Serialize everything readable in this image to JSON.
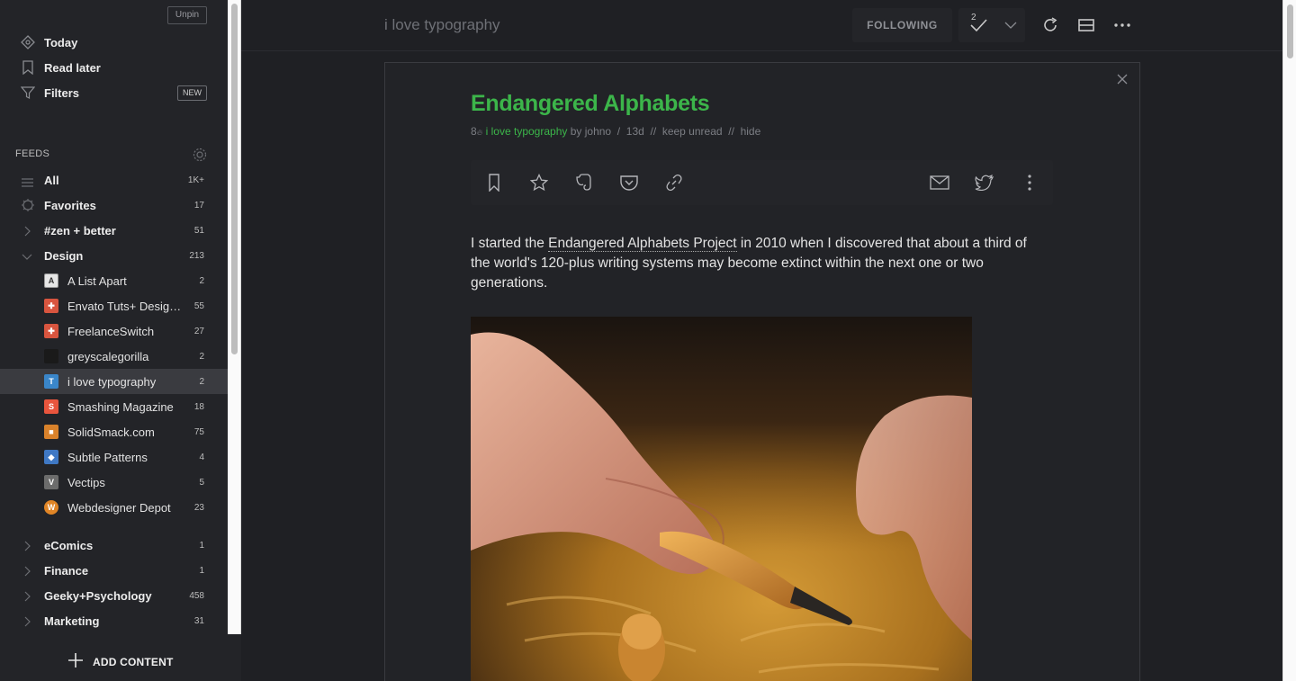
{
  "sidebar": {
    "unpin": "Unpin",
    "nav": [
      {
        "label": "Today",
        "icon": "today-icon"
      },
      {
        "label": "Read later",
        "icon": "bookmark-icon"
      },
      {
        "label": "Filters",
        "icon": "filter-icon",
        "badge": "NEW"
      }
    ],
    "feeds_label": "FEEDS",
    "groups_top": [
      {
        "label": "All",
        "count": "1K+",
        "icon": "list-icon"
      },
      {
        "label": "Favorites",
        "count": "17",
        "icon": "favorites-icon"
      },
      {
        "label": "#zen + better",
        "count": "51",
        "icon": "chevron-right-icon"
      },
      {
        "label": "Design",
        "count": "213",
        "icon": "chevron-down-icon"
      }
    ],
    "design_feeds": [
      {
        "label": "A List Apart",
        "count": "2",
        "favicon_color": "#e6e6e6",
        "favicon_text": "A"
      },
      {
        "label": "Envato Tuts+ Design & Illustration",
        "count": "55",
        "favicon_color": "#d8553f",
        "favicon_text": "+"
      },
      {
        "label": "FreelanceSwitch",
        "count": "27",
        "favicon_color": "#d8553f",
        "favicon_text": "+"
      },
      {
        "label": "greyscalegorilla",
        "count": "2",
        "favicon_color": "#1a1a1a",
        "favicon_text": ""
      },
      {
        "label": "i love typography",
        "count": "2",
        "favicon_color": "#3a86c9",
        "favicon_text": "T"
      },
      {
        "label": "Smashing Magazine",
        "count": "18",
        "favicon_color": "#e8553d",
        "favicon_text": "S"
      },
      {
        "label": "SolidSmack.com",
        "count": "75",
        "favicon_color": "#d9822b",
        "favicon_text": ""
      },
      {
        "label": "Subtle Patterns",
        "count": "4",
        "favicon_color": "#3f78c4",
        "favicon_text": "◆"
      },
      {
        "label": "Vectips",
        "count": "5",
        "favicon_color": "#6c6c6c",
        "favicon_text": "V"
      },
      {
        "label": "Webdesigner Depot",
        "count": "23",
        "favicon_color": "#e08526",
        "favicon_text": "W"
      }
    ],
    "groups_bottom": [
      {
        "label": "eComics",
        "count": "1"
      },
      {
        "label": "Finance",
        "count": "1"
      },
      {
        "label": "Geeky+Psychology",
        "count": "458"
      },
      {
        "label": "Marketing",
        "count": "31"
      }
    ],
    "add_content": "ADD CONTENT"
  },
  "topbar": {
    "feed_title": "i love typography",
    "following": "FOLLOWING",
    "mark_read_count": "2"
  },
  "article": {
    "title": "Endangered Alphabets",
    "meta": {
      "engagement": "8",
      "source": "i love typography",
      "by": "by johno",
      "sep1": "/",
      "age": "13d",
      "sep2": "//",
      "keep_unread": "keep unread",
      "sep3": "//",
      "hide": "hide"
    },
    "body_pre": "I started the ",
    "body_link": "Endangered Alphabets Project",
    "body_post": " in 2010 when I discovered that about a third of the world's 120-plus writing systems may become extinct within the next one or two generations."
  },
  "colors": {
    "accent": "#3cb54a",
    "sidebar_bg": "#232428",
    "main_bg": "#1f2024"
  }
}
